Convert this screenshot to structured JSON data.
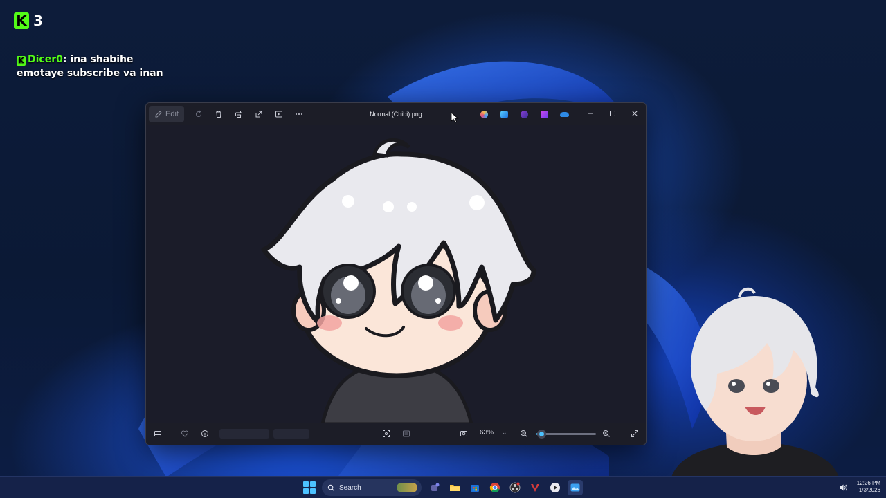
{
  "overlay": {
    "kick_logo": "K",
    "viewer_count": "3",
    "chat_user": "Dicer0",
    "chat_message": "ina shabihe emotaye subscribe va inan"
  },
  "window": {
    "title": "Normal (Chibi).png",
    "toolbar": {
      "edit_label": "Edit",
      "icons": [
        "edit-icon",
        "rotate-icon",
        "delete-icon",
        "print-icon",
        "share-icon",
        "slideshow-icon",
        "more-icon"
      ]
    },
    "app_icons": [
      "copilot-icon",
      "photos-icon",
      "clipchamp-icon",
      "designer-icon",
      "onedrive-icon"
    ],
    "controls": [
      "minimize",
      "maximize",
      "close"
    ],
    "footer": {
      "zoom_value": "63%",
      "zoom_fraction": 0.08,
      "icons": [
        "filmstrip-icon",
        "favorite-icon",
        "info-icon",
        "fit-icon",
        "compare-icon",
        "screenshot-icon",
        "zoom-out-icon",
        "zoom-in-icon",
        "fullscreen-icon"
      ]
    }
  },
  "taskbar": {
    "search_placeholder": "Search",
    "pinned": [
      "widgets",
      "teams",
      "file-explorer",
      "microsoft-store",
      "chrome",
      "obs",
      "vpn",
      "media-player",
      "photos"
    ],
    "time": "12:26 PM",
    "date": "1/3/2026"
  },
  "colors": {
    "kick_green": "#53fc18",
    "accent": "#4cc2ff",
    "window_bg": "#1c1d27"
  }
}
